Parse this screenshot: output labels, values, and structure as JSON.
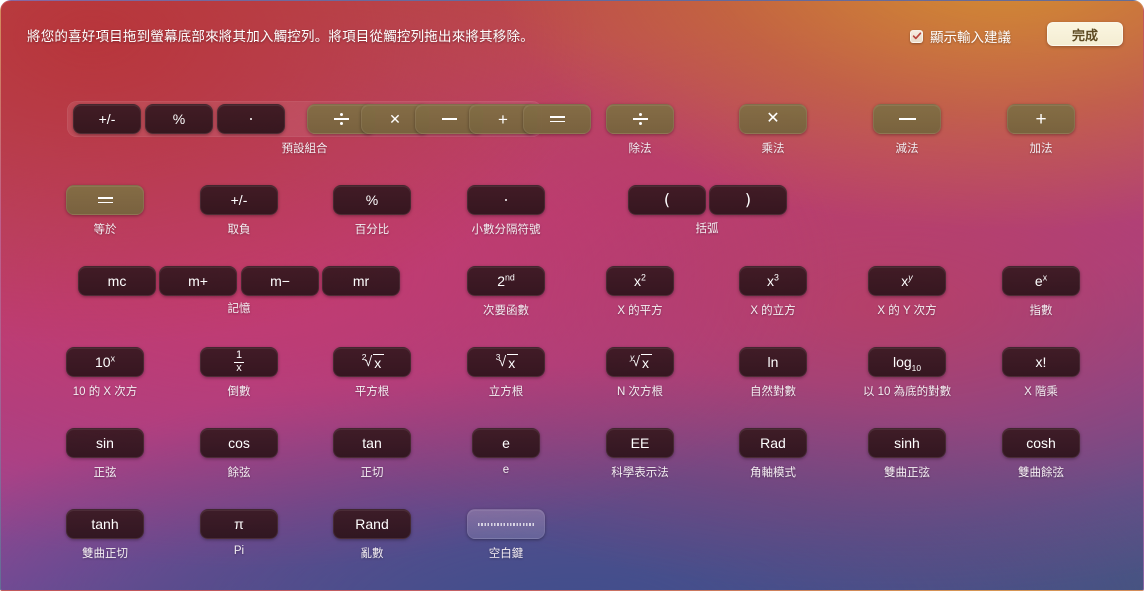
{
  "header": {
    "instruction": "將您的喜好項目拖到螢幕底部來將其加入觸控列。將項目從觸控列拖出來將其移除。",
    "suggestion_label": "顯示輸入建議",
    "suggestion_checked": true,
    "done_label": "完成",
    "checkbox_icon": "checkmark-icon"
  },
  "colors": {
    "button_dark": "#3a1a22",
    "button_olive": "#836e45",
    "done_button": "#fbf6e0",
    "label_text": "#f4eef2"
  },
  "groups": {
    "default_set_caption": "預設組合",
    "parentheses_caption": "括弧",
    "memory_caption": "記憶"
  },
  "default_set": {
    "buttons": [
      {
        "glyph": "+/-",
        "style": "dark",
        "name": "plus-minus"
      },
      {
        "glyph": "%",
        "style": "dark",
        "name": "percent"
      },
      {
        "glyph": ".",
        "style": "dark",
        "name": "decimal"
      },
      {
        "glyph": "÷",
        "style": "olive",
        "name": "divide"
      },
      {
        "glyph": "×",
        "style": "olive",
        "name": "multiply"
      },
      {
        "glyph": "−",
        "style": "olive",
        "name": "subtract"
      },
      {
        "glyph": "+",
        "style": "olive",
        "name": "add"
      },
      {
        "glyph": "=",
        "style": "olive",
        "name": "equals"
      }
    ]
  },
  "items": {
    "divide": {
      "glyph": "÷",
      "caption": "除法"
    },
    "multiply": {
      "glyph": "×",
      "caption": "乘法"
    },
    "subtract": {
      "glyph": "−",
      "caption": "減法"
    },
    "add": {
      "glyph": "+",
      "caption": "加法"
    },
    "equals": {
      "glyph": "=",
      "caption": "等於"
    },
    "plusminus": {
      "glyph": "+/-",
      "caption": "取負"
    },
    "percent": {
      "glyph": "%",
      "caption": "百分比"
    },
    "decimal": {
      "glyph": ".",
      "caption": "小數分隔符號"
    },
    "paren_open": {
      "glyph": "(",
      "caption": ""
    },
    "paren_close": {
      "glyph": ")",
      "caption": ""
    },
    "mc": {
      "glyph": "mc",
      "caption": ""
    },
    "mplus": {
      "glyph": "m+",
      "caption": ""
    },
    "mminus": {
      "glyph": "m−",
      "caption": ""
    },
    "mr": {
      "glyph": "mr",
      "caption": ""
    },
    "second": {
      "glyph": "2nd",
      "caption": "次要函數"
    },
    "x_squared": {
      "glyph": "x²",
      "caption": "X 的平方"
    },
    "x_cubed": {
      "glyph": "x³",
      "caption": "X 的立方"
    },
    "x_pow_y": {
      "glyph": "xʸ",
      "caption": "X 的 Y 次方"
    },
    "e_pow_x": {
      "glyph": "eˣ",
      "caption": "指數"
    },
    "ten_pow_x": {
      "glyph": "10ˣ",
      "caption": "10 的 X 次方"
    },
    "reciprocal": {
      "glyph": "1/x",
      "caption": "倒數"
    },
    "sqrt": {
      "glyph": "²√x",
      "caption": "平方根"
    },
    "cbrt": {
      "glyph": "³√x",
      "caption": "立方根"
    },
    "nthroot": {
      "glyph": "ʸ√x",
      "caption": "N 次方根"
    },
    "ln": {
      "glyph": "ln",
      "caption": "自然對數"
    },
    "log10": {
      "glyph": "log10",
      "caption": "以 10 為底的對數"
    },
    "factorial": {
      "glyph": "x!",
      "caption": "X 階乘"
    },
    "sin": {
      "glyph": "sin",
      "caption": "正弦"
    },
    "cos": {
      "glyph": "cos",
      "caption": "餘弦"
    },
    "tan": {
      "glyph": "tan",
      "caption": "正切"
    },
    "e": {
      "glyph": "e",
      "caption": "e"
    },
    "ee": {
      "glyph": "EE",
      "caption": "科學表示法"
    },
    "rad": {
      "glyph": "Rad",
      "caption": "角軸模式"
    },
    "sinh": {
      "glyph": "sinh",
      "caption": "雙曲正弦"
    },
    "cosh": {
      "glyph": "cosh",
      "caption": "雙曲餘弦"
    },
    "tanh": {
      "glyph": "tanh",
      "caption": "雙曲正切"
    },
    "pi": {
      "glyph": "π",
      "caption": "Pi"
    },
    "rand": {
      "glyph": "Rand",
      "caption": "亂數"
    },
    "space": {
      "glyph": "",
      "caption": "空白鍵"
    },
    "second_sup": "nd",
    "log_sub": "10"
  }
}
